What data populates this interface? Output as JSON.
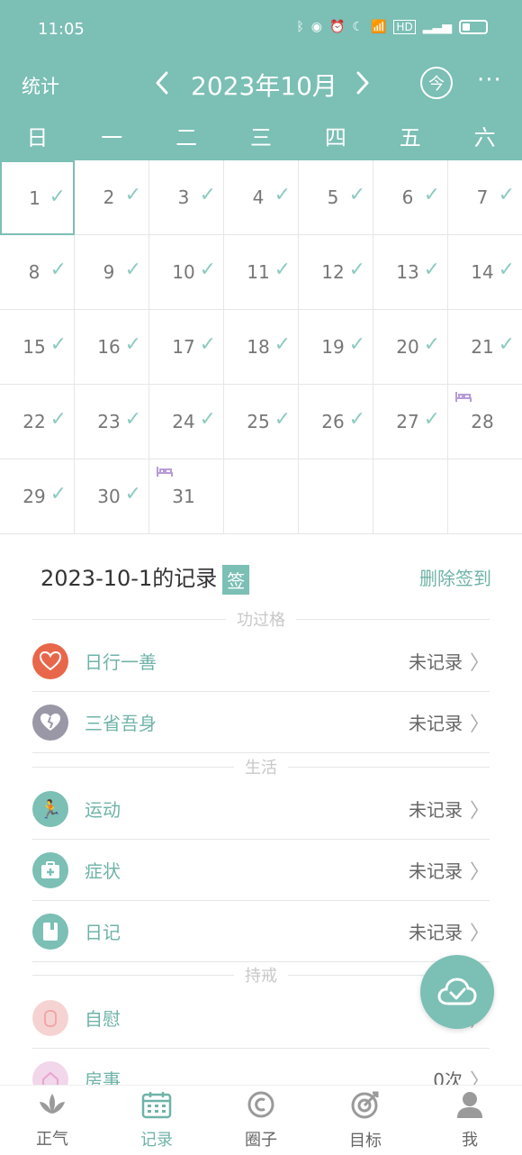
{
  "status_bar": {
    "time": "11:05"
  },
  "header": {
    "stats_label": "统计",
    "month_title": "2023年10月",
    "today_label": "今",
    "more_label": "···"
  },
  "weekdays": [
    "日",
    "一",
    "二",
    "三",
    "四",
    "五",
    "六"
  ],
  "calendar": {
    "days": [
      {
        "n": "1",
        "check": true,
        "selected": true
      },
      {
        "n": "2",
        "check": true
      },
      {
        "n": "3",
        "check": true
      },
      {
        "n": "4",
        "check": true
      },
      {
        "n": "5",
        "check": true
      },
      {
        "n": "6",
        "check": true
      },
      {
        "n": "7",
        "check": true
      },
      {
        "n": "8",
        "check": true
      },
      {
        "n": "9",
        "check": true
      },
      {
        "n": "10",
        "check": true
      },
      {
        "n": "11",
        "check": true
      },
      {
        "n": "12",
        "check": true
      },
      {
        "n": "13",
        "check": true
      },
      {
        "n": "14",
        "check": true
      },
      {
        "n": "15",
        "check": true
      },
      {
        "n": "16",
        "check": true
      },
      {
        "n": "17",
        "check": true
      },
      {
        "n": "18",
        "check": true
      },
      {
        "n": "19",
        "check": true
      },
      {
        "n": "20",
        "check": true
      },
      {
        "n": "21",
        "check": true
      },
      {
        "n": "22",
        "check": true
      },
      {
        "n": "23",
        "check": true
      },
      {
        "n": "24",
        "check": true
      },
      {
        "n": "25",
        "check": true
      },
      {
        "n": "26",
        "check": true
      },
      {
        "n": "27",
        "check": true
      },
      {
        "n": "28",
        "check": false,
        "marker": true
      },
      {
        "n": "29",
        "check": true
      },
      {
        "n": "30",
        "check": true
      },
      {
        "n": "31",
        "check": false,
        "marker": true
      },
      {
        "n": "",
        "check": false
      },
      {
        "n": "",
        "check": false
      },
      {
        "n": "",
        "check": false
      },
      {
        "n": "",
        "check": false
      }
    ]
  },
  "records": {
    "title": "2023-10-1的记录",
    "sign_badge": "签",
    "delete_label": "删除签到",
    "sections": {
      "merit": "功过格",
      "life": "生活",
      "precepts": "持戒"
    },
    "items": [
      {
        "title": "日行一善",
        "status": "未记录",
        "color": "#e8674a"
      },
      {
        "title": "三省吾身",
        "status": "未记录",
        "color": "#9a98a6"
      },
      {
        "title": "运动",
        "status": "未记录",
        "color": "#7bbfb5"
      },
      {
        "title": "症状",
        "status": "未记录",
        "color": "#7bbfb5"
      },
      {
        "title": "日记",
        "status": "未记录",
        "color": "#7bbfb5"
      },
      {
        "title": "自慰",
        "status": "",
        "color": "#f6d3d3"
      },
      {
        "title": "房事",
        "status": "0次",
        "color": "#f2d6ea"
      }
    ]
  },
  "tabs": [
    {
      "label": "正气",
      "icon": "lotus-icon"
    },
    {
      "label": "记录",
      "icon": "calendar-icon",
      "active": true
    },
    {
      "label": "圈子",
      "icon": "circle-icon"
    },
    {
      "label": "目标",
      "icon": "target-icon"
    },
    {
      "label": "我",
      "icon": "user-icon"
    }
  ]
}
